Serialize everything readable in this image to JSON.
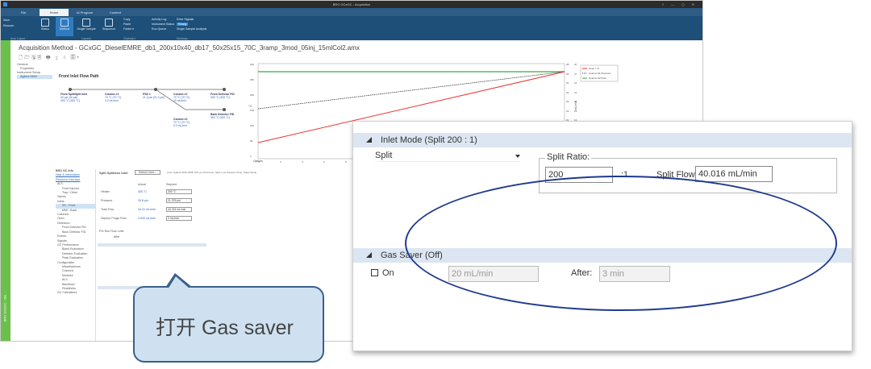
{
  "app": {
    "window_title": "BRO GCxGC - Acquisition",
    "window_controls": "? — ◻ ✕",
    "tabs": [
      "File",
      "Home",
      "AI Program",
      "Content"
    ],
    "ribbon": {
      "status": "Status",
      "method": "Method",
      "single_sample": "Single Sample",
      "sequence": "Sequence",
      "copy": "Copy",
      "paste": "Paste",
      "cut": "Cut",
      "folder": "Folder ▾",
      "activity_log": "Activity Log",
      "instrument_status": "Instrument Status",
      "run_queue": "Run Queue",
      "drive_signals": "Drive Signals",
      "ready": "Ready",
      "single_sample_analysis": "Single Sample Analysis",
      "groups": [
        "Auto Layout",
        "Layouts",
        "Clipboard",
        "Windows"
      ],
      "save": "Save",
      "recover": "Recover"
    },
    "leftbar_label": "BRO GCxGC - Idle"
  },
  "method": {
    "title": "Acquisition Method - GCxGC_DieselEMRE_db1_200x10x40_db17_50x25x15_70C_3ramp_3mod_05inj_15mlCol2.amx",
    "toolbar": "🗋🗁🖫🗎 🖶 ⇪ ⇩ 🗐▾",
    "tree": [
      "General",
      "Properties",
      "Instrument Setup",
      "Agilent 6890"
    ]
  },
  "flow": {
    "title": "Front Inlet Flow Path",
    "nodes": [
      {
        "name": "Front Split/Split Inlet",
        "l1": "40 psi (40 psi)",
        "l2": "300 °C (300 °C)"
      },
      {
        "name": "Column #1",
        "l1": "70 °C (70 °C)",
        "l2": "0.2 mL/min"
      },
      {
        "name": "PSD 1",
        "l1": "21.2 psi (21.2 psi)",
        "l2": ""
      },
      {
        "name": "Column #2",
        "l1": "70 °C (70 °C)",
        "l2": "20 mL/min"
      },
      {
        "name": "Front Detector FID",
        "l1": "300 °C (300 °C)",
        "l2": ""
      },
      {
        "name": "Column #3",
        "l1": "70 °C (70 °C)",
        "l2": "0.2 mL/min"
      },
      {
        "name": "Back Detector FID",
        "l1": "300 °C (300 °C)",
        "l2": ""
      }
    ]
  },
  "chart": {
    "y_ticks": [
      "300",
      "250",
      "200",
      "150",
      "100",
      "50",
      "0"
    ],
    "x_ticks": [
      "0",
      "2",
      "4",
      "6",
      "8",
      "10",
      "12",
      "14",
      "16",
      "18",
      "20",
      "22",
      "24",
      "26",
      "28"
    ],
    "y2_ticks": [
      "38",
      "35",
      "32",
      "29",
      "26",
      "23",
      "20",
      "17",
      "14",
      "11",
      "8"
    ],
    "y3_ticks": [
      "30",
      "27",
      "24",
      "21",
      "18",
      "15",
      "12",
      "9",
      "6",
      "3",
      "0"
    ],
    "legend": [
      "Oven / °C",
      "Column #1 Pressure",
      "Column #2 Flow"
    ],
    "ylabel_left": "°C",
    "ylabel_right": "mL/min",
    "ylabel_mid": "psi",
    "footer": "Options"
  },
  "nav": {
    "header": "BRO GC Info",
    "links": [
      "Help & Information",
      "Resource Interface"
    ],
    "items": [
      "ALS",
      "Front Injector",
      "Tray / Other",
      "Valves",
      "Inlets",
      "SS - Front",
      "MMI - Back",
      "Columns",
      "Oven",
      "Detectors",
      "Front Detector FID",
      "Back Detector FID",
      "Events",
      "Signals",
      "GC Performance",
      "Blank Evaluation",
      "Detector Evaluation",
      "Peak Evaluation",
      "Configuration",
      "Miscellaneous",
      "Columns",
      "Modules",
      "ALS",
      "Backflush",
      "Readiness",
      "GC Calculators"
    ]
  },
  "detail": {
    "title": "Split Splitless Inlet",
    "select_btn": "Select Liner...",
    "hint": "Liner: Agilent 5190-2295: 870 µL (Ultra Inert, Split, Low Pressure Drop, Glass Wool)",
    "col_actual": "Actual",
    "col_setpoint": "Setpoint",
    "rows": [
      {
        "label": "Heater",
        "actual": "300 °C",
        "set": "300 °C"
      },
      {
        "label": "Pressure",
        "actual": "20.6 psi",
        "set": "21.376 psi"
      },
      {
        "label": "Total Flow",
        "actual": "44.21 mL/min",
        "set": "44.216 mL/min"
      },
      {
        "label": "Septum Purge Flow",
        "actual": "3.000 mL/min",
        "set": "3 mL/min"
      }
    ],
    "pre_run": "Pre Run Flow Limit",
    "after": "After"
  },
  "zoom": {
    "inlet_header": "Inlet Mode (Split 200 : 1)",
    "mode": "Split",
    "ratio_legend": "Split Ratio:",
    "ratio_value": "200",
    "ratio_suffix": ":1",
    "split_flow_label": "Split Flow",
    "split_flow_value": "40.016 mL/min",
    "gas_saver_header": "Gas Saver (Off)",
    "on_label": "On",
    "gas_saver_flow": "20 mL/min",
    "after_label": "After:",
    "after_value": "3 min"
  },
  "callout": {
    "text": "打开 Gas saver"
  }
}
